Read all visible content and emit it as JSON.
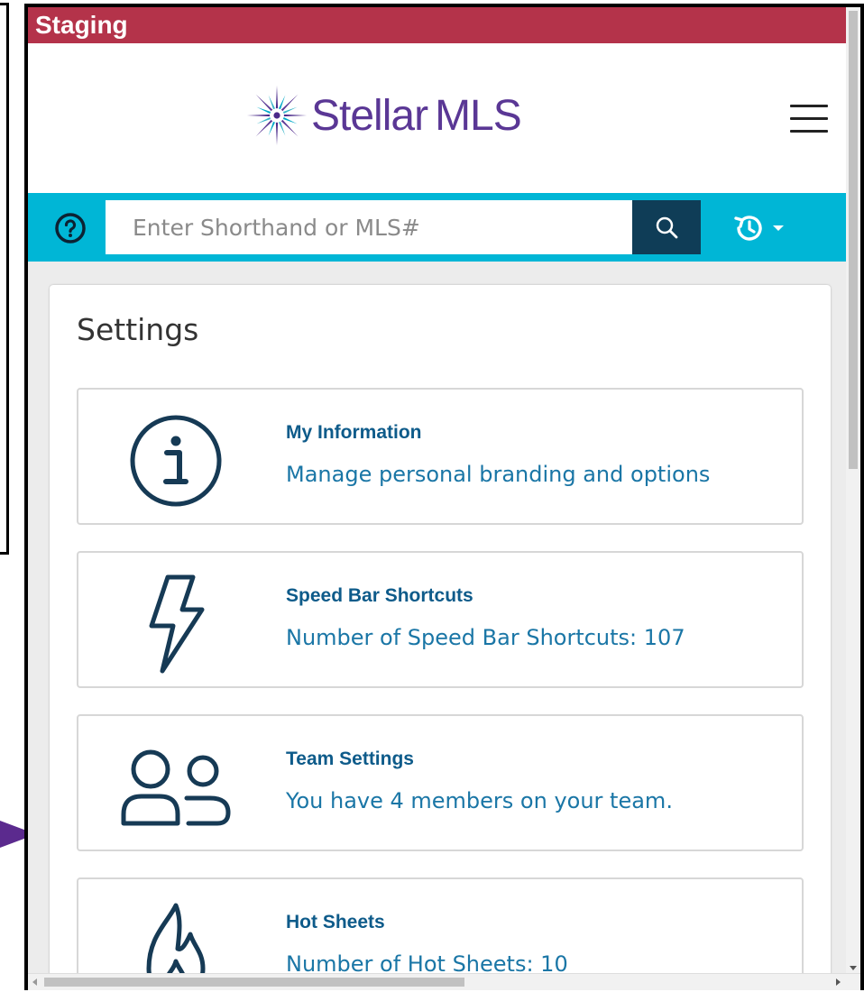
{
  "environment": {
    "label": "Staging"
  },
  "header": {
    "logo_word": "Stellar",
    "logo_suffix": "MLS"
  },
  "search": {
    "placeholder": "Enter Shorthand or MLS#",
    "value": ""
  },
  "settings": {
    "title": "Settings",
    "cards": [
      {
        "title": "My Information",
        "description": "Manage personal branding and options",
        "icon": "info-circle-icon"
      },
      {
        "title": "Speed Bar Shortcuts",
        "description": "Number of Speed Bar Shortcuts: 107",
        "icon": "lightning-bolt-icon"
      },
      {
        "title": "Team Settings",
        "description": "You have 4 members on your team.",
        "icon": "team-users-icon"
      },
      {
        "title": "Hot Sheets",
        "description": "Number of Hot Sheets: 10",
        "icon": "flame-icon"
      }
    ]
  },
  "colors": {
    "staging_bar": "#b4334a",
    "brand_purple": "#5a3795",
    "search_bar": "#00b6d6",
    "search_button": "#0f3d57",
    "card_title": "#0e5b8a",
    "card_text": "#1a76a6",
    "icon_stroke": "#163a55"
  }
}
